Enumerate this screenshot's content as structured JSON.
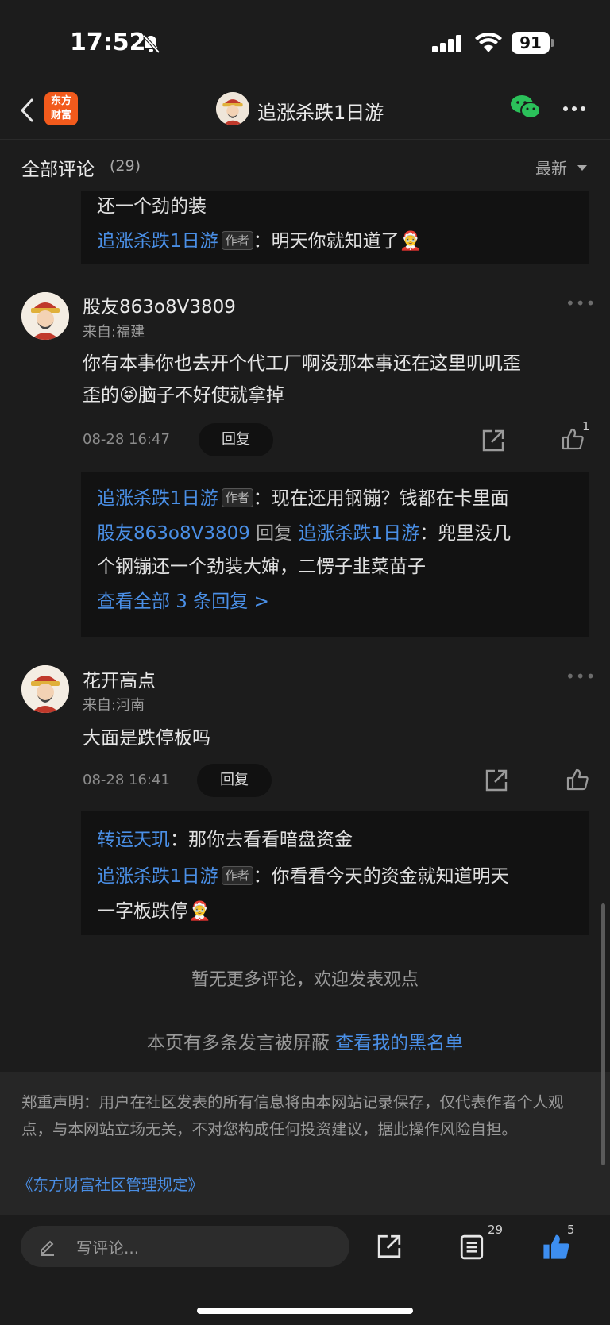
{
  "status_bar": {
    "time": "17:52",
    "battery": "91"
  },
  "nav": {
    "logo_line1": "东方",
    "logo_line2": "财富",
    "title": "追涨杀跌1日游"
  },
  "section": {
    "title": "全部评论",
    "count": "(29)",
    "sort": "最新"
  },
  "top_reply": {
    "line1": "还一个劲的装",
    "author": "追涨杀跌1日游",
    "badge": "作者",
    "text": "：明天你就知道了🤶"
  },
  "comments": [
    {
      "username": "股友863o8V3809",
      "location": "来自:福建",
      "content_line1": "你有本事你也去开个代工厂啊没那本事还在这里叽叽歪",
      "content_line2": "歪的😝脑子不好使就拿掉",
      "date": "08-28 16:47",
      "reply_label": "回复",
      "like_count": "1",
      "replies": {
        "r1_author": "追涨杀跌1日游",
        "r1_badge": "作者",
        "r1_text": "：现在还用钢镚？钱都在卡里面",
        "r2_user": "股友863o8V3809",
        "r2_verb": " 回复 ",
        "r2_target": "追涨杀跌1日游",
        "r2_text": "：兜里没几",
        "r2_line2": "个钢镚还一个劲装大婶，二愣子韭菜苗子",
        "view_all": "查看全部 3 条回复 >"
      }
    },
    {
      "username": "花开高点",
      "location": "来自:河南",
      "content_line1": "大面是跌停板吗",
      "date": "08-28 16:41",
      "reply_label": "回复",
      "replies": {
        "r1_author": "转运天玑",
        "r1_text": "：那你去看看暗盘资金",
        "r2_author": "追涨杀跌1日游",
        "r2_badge": "作者",
        "r2_text": "：你看看今天的资金就知道明天",
        "r2_line2": "一字板跌停🤶"
      }
    }
  ],
  "footer": {
    "no_more": "暂无更多评论，欢迎发表观点",
    "blocked_prefix": "本页有多条发言被屏蔽 ",
    "blacklist_link": "查看我的黑名单",
    "disclaimer": "郑重声明：用户在社区发表的所有信息将由本网站记录保存，仅代表作者个人观点，与本网站立场无关，不对您构成任何投资建议，据此操作风险自担。",
    "rules_link": "《东方财富社区管理规定》"
  },
  "bottom_bar": {
    "write_placeholder": "写评论...",
    "comment_count": "29",
    "like_count": "5",
    "accent": "#3d8ef0"
  }
}
